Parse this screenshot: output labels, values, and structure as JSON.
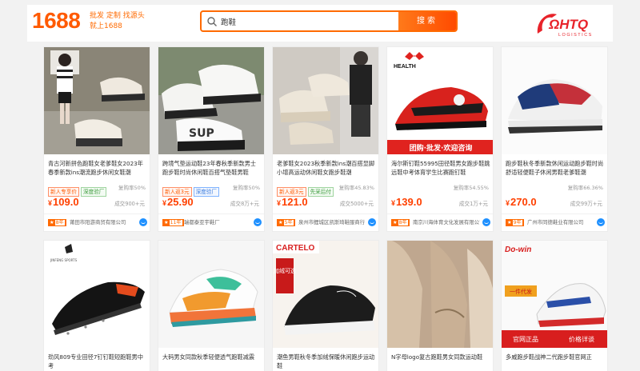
{
  "header": {
    "logo": "1688",
    "slogan_line1": "批发 定制 找源头",
    "slogan_line2": "就上1688",
    "search_value": "跑鞋",
    "search_button": "搜索",
    "brand_logo": "ΩHTQ",
    "brand_sub": "LOGISTICS"
  },
  "products": [
    {
      "title": "青古河新拼色跑鞋女老爹鞋女2023年春季新款ins潮流跑步休闲女鞋潮",
      "tag1": "新人专享价",
      "tag2": "深度验厂",
      "rate": "复购率50%",
      "price": "109.0",
      "sold": "成交900+元",
      "years": "8年",
      "shop": "莆田市阳游商贸有限公司"
    },
    {
      "title": "跨境气垫运动鞋23年春秋季新款男士跑步鞋时尚休闲鞋百搭气垫鞋男鞋",
      "tag1": "新人返3元",
      "tag2": "深度验厂",
      "rate": "复购率50%",
      "price": "25.90",
      "sold": "成交8万+元",
      "years": "11年",
      "shop": "瑞都泰亚宇鞋厂"
    },
    {
      "title": "老爹鞋女2023秋季新款ins潮百搭显脚小增高运动休闲鞋女跑步鞋潮",
      "tag1": "新人返3元",
      "tag2": "先采后付",
      "rate": "复购率45.83%",
      "price": "121.0",
      "sold": "成交5000+元",
      "years": "5年",
      "shop": "泉州市鲤城区凯斯琦鞋服商行"
    },
    {
      "title": "海尔斯钉鞋55995田径鞋男女跑步鞋跳远鞋中考体育学生比赛跑钉鞋",
      "tag1": "",
      "tag2": "",
      "rate": "复购率54.55%",
      "price": "139.0",
      "sold": "成交1万+元",
      "years": "8年",
      "shop": "南京川海体育文化发展有限公司",
      "banner": "团购·批发·欢迎咨询"
    },
    {
      "title": "跑步鞋秋冬季新款休闲运动跑步鞋时尚舒适轻便鞋子休闲男鞋老爹鞋潮",
      "tag1": "",
      "tag2": "",
      "rate": "复购率66.36%",
      "price": "270.0",
      "sold": "成交99万+元",
      "years": "9年",
      "shop": "广州市同德鞋业有限公司"
    },
    {
      "title": "劲风809专业田径7钉钉鞋短跑鞋男中考",
      "shop": "",
      "price": "",
      "sold": ""
    },
    {
      "title": "大码男女同款秋季轻便透气跑鞋减震",
      "shop": "",
      "price": "",
      "sold": ""
    },
    {
      "title": "潮鱼男鞋秋冬季加绒保暖休闲跑步运动鞋",
      "shop": "",
      "price": "",
      "sold": "",
      "brand": "CARTELO",
      "badge": "加绒可选"
    },
    {
      "title": "N字母logo复古跑鞋男女同款运动鞋",
      "shop": "",
      "price": "",
      "sold": ""
    },
    {
      "title": "多威跑步鞋战神二代跑步鞋官网正",
      "shop": "",
      "price": "",
      "sold": "",
      "brand": "Do-win",
      "promo1": "一件代发",
      "promo2": "官网正品",
      "promo3": "价格详谈"
    }
  ],
  "colors": {
    "accent": "#ff6a00",
    "price": "#ff4000",
    "brand": "#e8232a"
  }
}
